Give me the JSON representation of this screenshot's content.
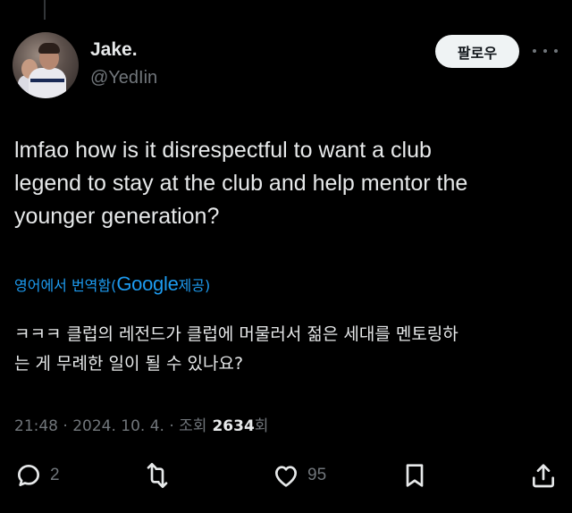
{
  "author": {
    "display_name": "Jake.",
    "handle": "@YedIin"
  },
  "follow_button": {
    "label": "팔로우"
  },
  "tweet": {
    "lines": [
      "lmfao how is it disrespectful to want a club",
      "legend to stay at the club and help mentor the",
      "younger generation?"
    ]
  },
  "translation": {
    "label_prefix": "영어에서 번역함(",
    "provider": "Google",
    "label_suffix": " 제공)",
    "lines": [
      "ㅋㅋㅋ 클럽의 레전드가 클럽에 머물러서 젊은 세대를 멘토링하",
      "는 게 무례한 일이 될 수 있나요?"
    ]
  },
  "meta": {
    "time": "21:48",
    "separator": " · ",
    "date": "2024. 10. 4.",
    "separator2": " · ",
    "views_label": "조회",
    "views_count": "2634",
    "views_suffix": "회"
  },
  "actions": {
    "reply_count": "2",
    "retweet_count": "",
    "like_count": "95"
  },
  "icons": {
    "reply": "reply-icon",
    "retweet": "retweet-icon",
    "like": "heart-icon",
    "bookmark": "bookmark-icon",
    "share": "share-icon",
    "more": "more-icon"
  },
  "colors": {
    "background": "#000000",
    "text": "#e7e9ea",
    "muted": "#71767b",
    "link": "#1d9bf0"
  }
}
